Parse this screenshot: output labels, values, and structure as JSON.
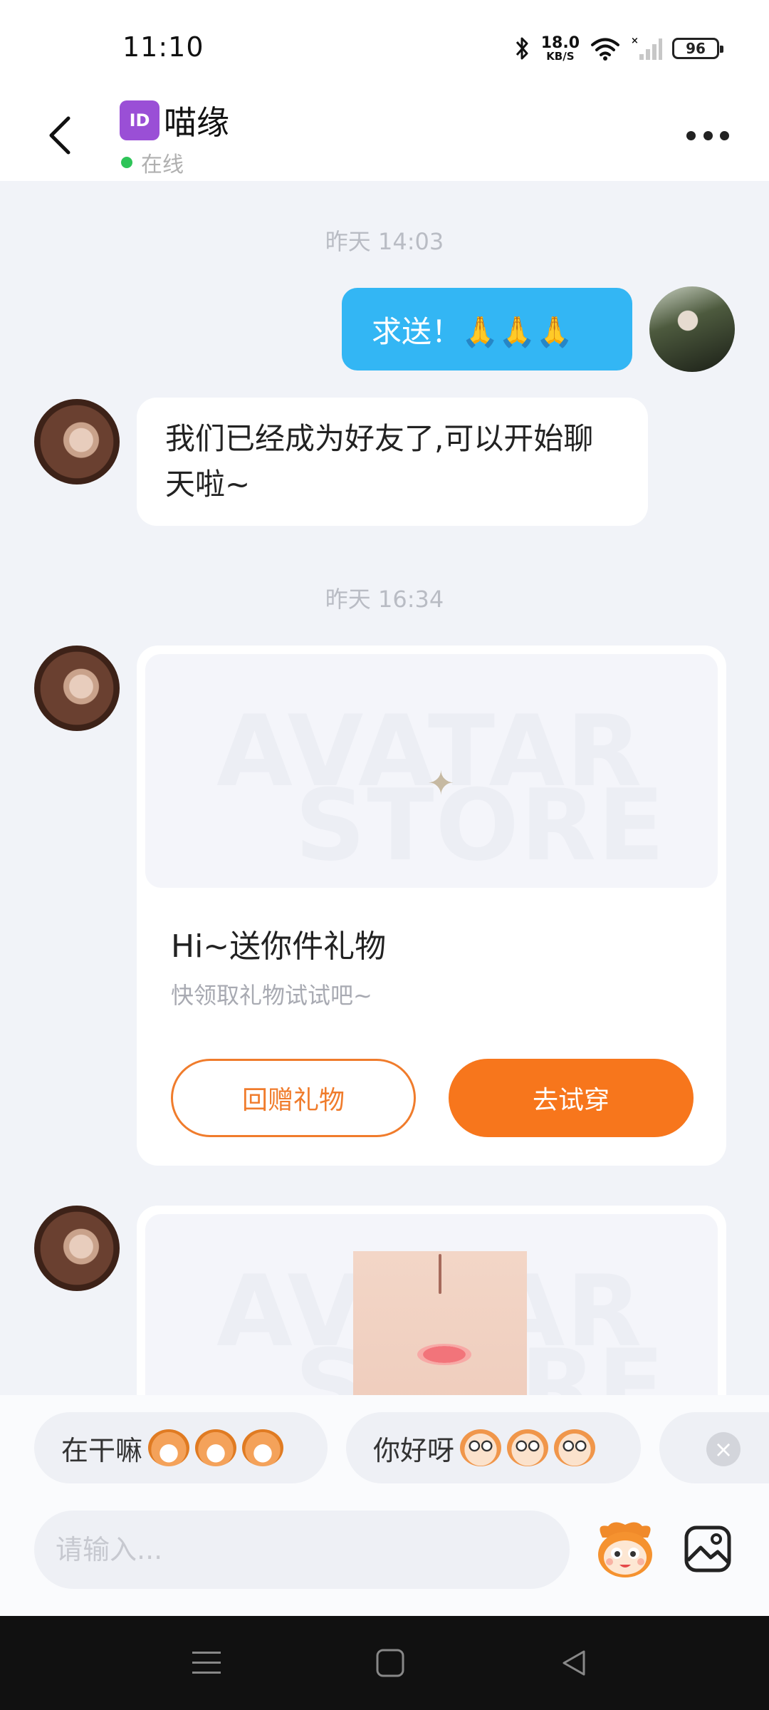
{
  "status_bar": {
    "time": "11:10",
    "net_speed_value": "18.0",
    "net_speed_unit": "KB/S",
    "battery": "96",
    "icons": [
      "bluetooth-icon",
      "wifi-icon",
      "signal-icon",
      "battery-icon"
    ]
  },
  "header": {
    "badge": "ID",
    "title": "喵缘",
    "status": "在线",
    "status_color": "#2ec458"
  },
  "chat": {
    "timestamp_1": "昨天 14:03",
    "outgoing_message": "求送！🙏🙏🙏",
    "incoming_message": "我们已经成为好友了,可以开始聊天啦~",
    "timestamp_2": "昨天 16:34",
    "gift_card": {
      "watermark_line1": "AVATAR",
      "watermark_line2": "STORE",
      "title": "Hi~送你件礼物",
      "subtitle": "快领取礼物试试吧~",
      "return_gift_button": "回赠礼物",
      "try_on_button": "去试穿"
    },
    "second_card": {
      "watermark_line1": "AVATAR",
      "watermark_line2": "STORE"
    }
  },
  "quick_replies": [
    {
      "text": "在干嘛"
    },
    {
      "text": "你好呀"
    }
  ],
  "input": {
    "placeholder": "请输入..."
  },
  "colors": {
    "accent_blue": "#33b6f4",
    "accent_orange": "#f7761c",
    "background": "#f1f3f8"
  }
}
